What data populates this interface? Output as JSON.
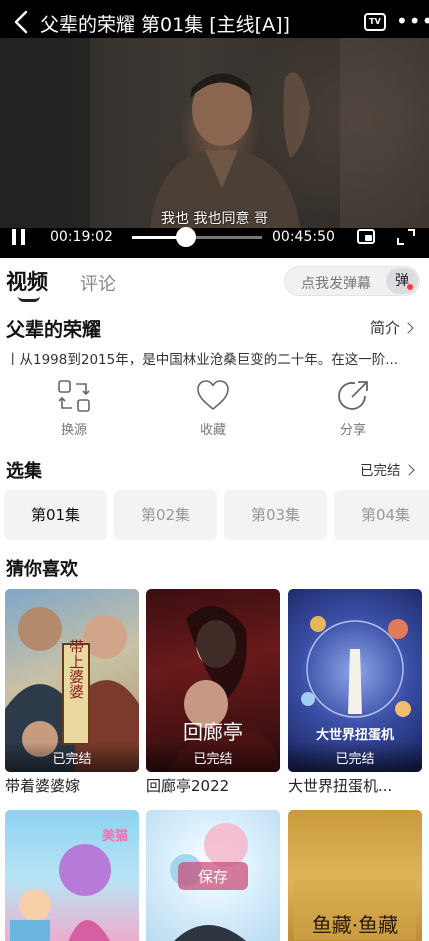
{
  "player": {
    "title": "父辈的荣耀 第01集 [主线[A]]",
    "tv_label": "TV",
    "more": "•••",
    "subtitle": "我也  我也同意  哥",
    "current_time": "00:19:02",
    "duration": "00:45:50",
    "progress": 0.415
  },
  "tabs": {
    "video": "视频",
    "comment": "评论",
    "danmu_placeholder": "点我发弹幕",
    "danmu_button": "弹"
  },
  "info": {
    "title": "父辈的荣耀",
    "intro": "简介",
    "description": "丨从1998到2015年，是中国林业沧桑巨变的二十年。在这一阶..."
  },
  "actions": [
    {
      "label": "换源",
      "icon": "switch-source-icon"
    },
    {
      "label": "收藏",
      "icon": "heart-icon"
    },
    {
      "label": "分享",
      "icon": "share-icon"
    }
  ],
  "episodes": {
    "title": "选集",
    "status": "已完结",
    "items": [
      "第01集",
      "第02集",
      "第03集",
      "第04集"
    ]
  },
  "recommend": {
    "title": "猜你喜欢",
    "items": [
      {
        "title": "带着婆婆嫁",
        "badge": "已完结",
        "poster_text": "带上婆婆"
      },
      {
        "title": "回廊亭2022",
        "badge": "已完结",
        "poster_text": "回廊亭"
      },
      {
        "title": "大世界扭蛋机...",
        "badge": "已完结",
        "poster_text": "大世界扭蛋机"
      },
      {
        "title": "",
        "badge": "",
        "poster_text": "美猫"
      },
      {
        "title": "",
        "badge": "",
        "poster_text": "保存"
      },
      {
        "title": "",
        "badge": "",
        "poster_text": "鱼藏·鱼藏"
      }
    ]
  }
}
